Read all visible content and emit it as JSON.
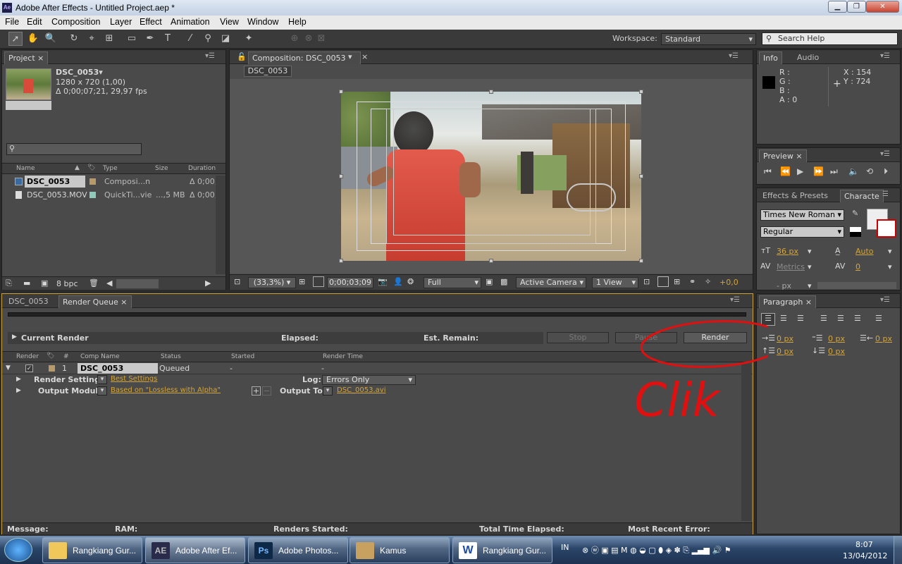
{
  "window": {
    "title": "Adobe After Effects - Untitled Project.aep *",
    "app_icon": "Ae"
  },
  "menu": [
    "File",
    "Edit",
    "Composition",
    "Layer",
    "Effect",
    "Animation",
    "View",
    "Window",
    "Help"
  ],
  "toolbar": {
    "workspace_label": "Workspace:",
    "workspace_value": "Standard",
    "search_placeholder": "Search Help"
  },
  "project": {
    "tab": "Project",
    "comp_name": "DSC_0053▾",
    "dims": "1280 x 720 (1,00)",
    "duration": "Δ 0;00;07;21, 29,97 fps",
    "columns": {
      "name": "Name",
      "type": "Type",
      "size": "Size",
      "duration": "Duration"
    },
    "items": [
      {
        "name": "DSC_0053",
        "type": "Composi...n",
        "size": "",
        "duration": "Δ 0;00;"
      },
      {
        "name": "DSC_0053.MOV",
        "type": "QuickTi...vie",
        "size": "...,5 MB",
        "duration": "Δ 0;00;"
      }
    ],
    "bpc": "8 bpc"
  },
  "composition": {
    "tab": "Composition: DSC_0053",
    "sub_tab": "DSC_0053",
    "zoom": "(33,3%)",
    "timecode": "0;00;03;09",
    "resolution": "Full",
    "camera": "Active Camera",
    "view": "1 View",
    "exposure": "+0,0"
  },
  "info": {
    "tab": "Info",
    "tab2": "Audio",
    "r": "R :",
    "g": "G :",
    "b": "B :",
    "a": "A : 0",
    "x": "X : 154",
    "y": "Y : 724"
  },
  "preview": {
    "tab": "Preview"
  },
  "character": {
    "tab1": "Effects & Presets",
    "tab2": "Characte",
    "font": "Times New Roman",
    "style": "Regular",
    "size": "36 px",
    "leading": "Auto",
    "kerning": "Metrics",
    "tracking": "0",
    "bottom": "- px"
  },
  "paragraph": {
    "tab": "Paragraph",
    "indent1": "0 px",
    "indent2": "0 px",
    "indent3": "0 px",
    "space1": "0 px",
    "space2": "0 px"
  },
  "render_queue": {
    "tab1": "DSC_0053",
    "tab2": "Render Queue",
    "current_render": "Current Render",
    "elapsed": "Elapsed:",
    "est_remain": "Est. Remain:",
    "stop": "Stop",
    "pause": "Pause",
    "render": "Render",
    "columns": {
      "render": "Render",
      "num": "#",
      "comp_name": "Comp Name",
      "status": "Status",
      "started": "Started",
      "render_time": "Render Time"
    },
    "item": {
      "num": "1",
      "comp": "DSC_0053",
      "status": "Queued",
      "started": "-",
      "render_time": "-"
    },
    "render_settings_label": "Render Settings:",
    "render_settings_value": "Best Settings",
    "log_label": "Log:",
    "log_value": "Errors Only",
    "output_module_label": "Output Module:",
    "output_module_value": "Based on \"Lossless with Alpha\"",
    "output_to_label": "Output To:",
    "output_to_value": "DSC_0053.avi",
    "annotation": "Clik"
  },
  "statusbar": {
    "message": "Message:",
    "ram": "RAM:",
    "renders_started": "Renders Started:",
    "total_time": "Total Time Elapsed:",
    "recent_error": "Most Recent Error:"
  },
  "taskbar": {
    "items": [
      {
        "label": "Rangkiang Gur...",
        "icon": "folder-icon"
      },
      {
        "label": "Adobe After Ef...",
        "icon": "AE"
      },
      {
        "label": "Adobe Photos...",
        "icon": "Ps"
      },
      {
        "label": "Kamus",
        "icon": "book-icon"
      },
      {
        "label": "Rangkiang Gur...",
        "icon": "W"
      }
    ],
    "lang": "IN",
    "time": "8:07",
    "date": "13/04/2012"
  }
}
